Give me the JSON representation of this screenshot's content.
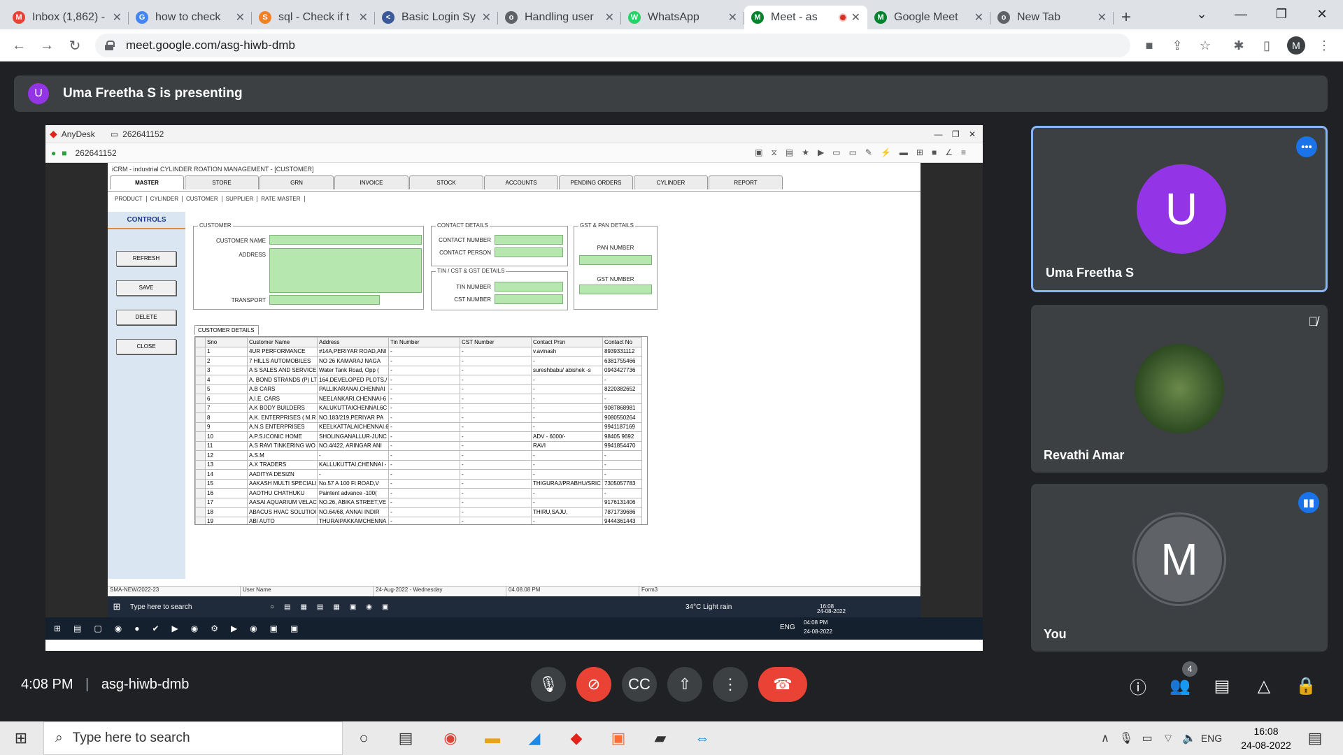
{
  "browser": {
    "tabs": [
      {
        "label": "Inbox (1,862) -",
        "icon": "gmail",
        "color": "#ea4335",
        "glyph": "M"
      },
      {
        "label": "how to check",
        "icon": "google",
        "color": "#4285f4",
        "glyph": "G"
      },
      {
        "label": "sql - Check if t",
        "icon": "stackoverflow",
        "color": "#f48024",
        "glyph": "S"
      },
      {
        "label": "Basic Login Sy",
        "icon": "code",
        "color": "#3b5998",
        "glyph": "<"
      },
      {
        "label": "Handling user",
        "icon": "globe",
        "color": "#5f6368",
        "glyph": "o"
      },
      {
        "label": "WhatsApp",
        "icon": "whatsapp",
        "color": "#25d366",
        "glyph": "W"
      },
      {
        "label": "Meet - as",
        "icon": "meet",
        "color": "#00832d",
        "glyph": "M",
        "active": true
      },
      {
        "label": "Google Meet",
        "icon": "meet",
        "color": "#00832d",
        "glyph": "M"
      },
      {
        "label": "New Tab",
        "icon": "chrome",
        "color": "#5f6368",
        "glyph": "o"
      }
    ],
    "url": "meet.google.com/asg-hiwb-dmb",
    "profile_initial": "M"
  },
  "meet": {
    "presenter_initial": "U",
    "presenting_text": "Uma Freetha S is presenting",
    "participants": [
      {
        "name": "Uma Freetha S",
        "initial": "U",
        "color": "#9334e6"
      },
      {
        "name": "Revathi Amar",
        "initial": "",
        "color": "#2e5b2b"
      },
      {
        "name": "You",
        "initial": "M",
        "color": "#5f6368"
      }
    ],
    "time": "4:08 PM",
    "meeting_code": "asg-hiwb-dmb",
    "people_count": "4"
  },
  "anydesk": {
    "app_name": "AnyDesk",
    "session_id": "262641152"
  },
  "app": {
    "title": "iCRM - industrial CYLINDER ROATION MANAGEMENT - [CUSTOMER]",
    "main_tabs": [
      "MASTER",
      "STORE",
      "GRN",
      "INVOICE",
      "STOCK",
      "ACCOUNTS",
      "PENDING ORDERS",
      "CYLINDER",
      "REPORT"
    ],
    "sub_tabs": [
      "PRODUCT",
      "CYLINDER",
      "CUSTOMER",
      "SUPPLIER",
      "RATE MASTER"
    ],
    "controls_title": "CONTROLS",
    "buttons": [
      "REFRESH",
      "SAVE",
      "DELETE",
      "CLOSE"
    ],
    "customer_section": "CUSTOMER",
    "customer_name_label": "CUSTOMER NAME",
    "address_label": "ADDRESS",
    "transport_label": "TRANSPORT",
    "contact_section": "CONTACT DETAILS",
    "contact_number_label": "CONTACT NUMBER",
    "contact_person_label": "CONTACT PERSON",
    "tin_section": "TIN / CST & GST DETAILS",
    "tin_label": "TIN NUMBER",
    "cst_label": "CST NUMBER",
    "gst_section": "GST & PAN DETAILS",
    "pan_label": "PAN NUMBER",
    "gst_label": "GST NUMBER",
    "grid_title": "CUSTOMER DETAILS",
    "columns": [
      "Sno",
      "Customer Name",
      "Address",
      "Tin Number",
      "CST Number",
      "Contact Prsn",
      "Contact No"
    ],
    "rows": [
      [
        "1",
        "4UR PERFORMANCE",
        "#14A,PERIYAR ROAD,ANI",
        "-",
        "-",
        "v.avinash",
        "8939331112"
      ],
      [
        "2",
        "7 HILLS AUTOMOBILES",
        "NO 26 KAMARAJ NAGA",
        "-",
        "-",
        "-",
        "6381755466"
      ],
      [
        "3",
        "A S SALES AND SERVICES",
        "Water Tank Road, Opp (",
        "-",
        "-",
        "sureshbabu/ abishek -s",
        "0943427736"
      ],
      [
        "4",
        "A. BOND STRANDS (P) LT",
        "164,DEVELOPED PLOTS,/",
        "-",
        "-",
        "-",
        "-"
      ],
      [
        "5",
        "A.B CARS",
        "PALLIKARANAI,CHENNAI",
        "-",
        "-",
        "-",
        "8220382652"
      ],
      [
        "6",
        "A.I.E. CARS",
        "NEELANKARI,CHENNAI-6",
        "-",
        "-",
        "-",
        "-"
      ],
      [
        "7",
        "A.K BODY BUILDERS",
        "KALUKUTTAICHENNAI,6C",
        "-",
        "-",
        "-",
        "9087868981"
      ],
      [
        "8",
        "A.K. ENTERPRISES ( M.R",
        "NO.183/219,PERIYAR PA",
        "-",
        "-",
        "-",
        "9080550264"
      ],
      [
        "9",
        "A.N.S ENTERPRISES",
        "KEELKATTALAICHENNAI.6",
        "-",
        "-",
        "-",
        "9941187169"
      ],
      [
        "10",
        "A.P.S.ICONIC HOME",
        "SHOLINGANALLUR-JUNC",
        "-",
        "-",
        "ADV - 6000/-",
        "98405 9692"
      ],
      [
        "11",
        "A.S RAVI TINKERING WO",
        "NO.4/422, ARINGAR ANI",
        "-",
        "-",
        "RAVI",
        "9941854470"
      ],
      [
        "12",
        "A.S.M",
        "-",
        "-",
        "-",
        "-",
        "-"
      ],
      [
        "13",
        "A.X TRADERS",
        "KALLUKUTTAI,CHENNAI -",
        "-",
        "-",
        "-",
        "-"
      ],
      [
        "14",
        "AADITYA DESIZN",
        "-",
        "-",
        "-",
        "-",
        "-"
      ],
      [
        "15",
        "AAKASH MULTI SPECIALI",
        "No.57 A 100 Ft ROAD,V",
        "-",
        "-",
        "THIGURAJ/PRABHU/SRIC",
        "7305057783"
      ],
      [
        "16",
        "AAOTHU CHATHUKU",
        "Paintent advance -100(",
        "-",
        "-",
        "-",
        "-"
      ],
      [
        "17",
        "AASAI AQUARIUM VELAC",
        "NO.26, ABIKA STREET,VE",
        "-",
        "-",
        "-",
        "9176131406"
      ],
      [
        "18",
        "ABACUS HVAC SOLUTIOI",
        "NO.64/68, ANNAI INDIR",
        "-",
        "-",
        "THIRU,SAJU,",
        "7871739686"
      ],
      [
        "19",
        "ABI AUTO",
        "THURAIPAKKAMCHENNA",
        "-",
        "-",
        "-",
        "9444361443"
      ]
    ],
    "status": [
      "SMA-NEW/2022-23",
      "User Name",
      "24-Aug-2022 - Wednesday",
      "04.08.08 PM",
      "Form3"
    ]
  },
  "remote_taskbar": {
    "search_placeholder": "Type here to search",
    "weather": "34°C  Light rain",
    "time": "16:08",
    "date": "24-08-2022"
  },
  "remote_taskbar2": {
    "lang": "ENG",
    "time": "04:08 PM",
    "date": "24-08-2022"
  },
  "taskbar": {
    "search_placeholder": "Type here to search",
    "lang": "ENG",
    "time": "16:08",
    "date": "24-08-2022"
  }
}
